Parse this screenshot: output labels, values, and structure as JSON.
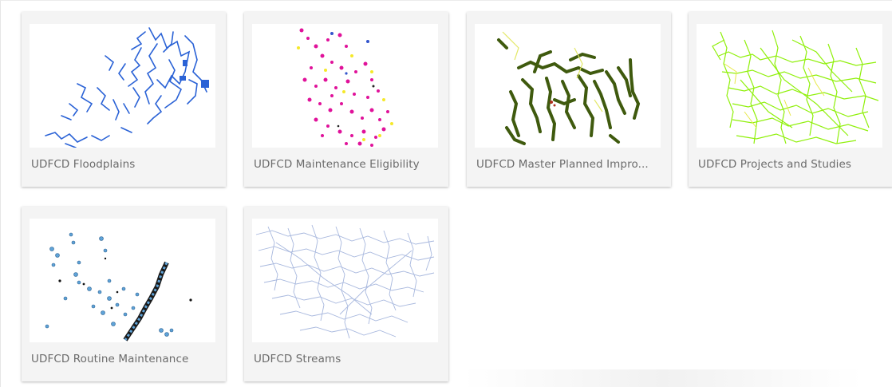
{
  "cards": [
    {
      "title": "UDFCD Floodplains",
      "thumbnail_icon": "floodplains-map-icon",
      "thumb_color": "#2a62d6"
    },
    {
      "title": "UDFCD Maintenance Eligibility",
      "thumbnail_icon": "maintenance-eligibility-map-icon",
      "thumb_color": "#e0129a"
    },
    {
      "title": "UDFCD Master Planned Impro...",
      "thumbnail_icon": "master-planned-map-icon",
      "thumb_color": "#3f5a0e"
    },
    {
      "title": "UDFCD Projects and Studies",
      "thumbnail_icon": "projects-studies-map-icon",
      "thumb_color": "#8ff00a"
    },
    {
      "title": "UDFCD Routine Maintenance",
      "thumbnail_icon": "routine-maintenance-map-icon",
      "thumb_color": "#5fa3d8"
    },
    {
      "title": "UDFCD Streams",
      "thumbnail_icon": "streams-map-icon",
      "thumb_color": "#a8b8de"
    }
  ]
}
